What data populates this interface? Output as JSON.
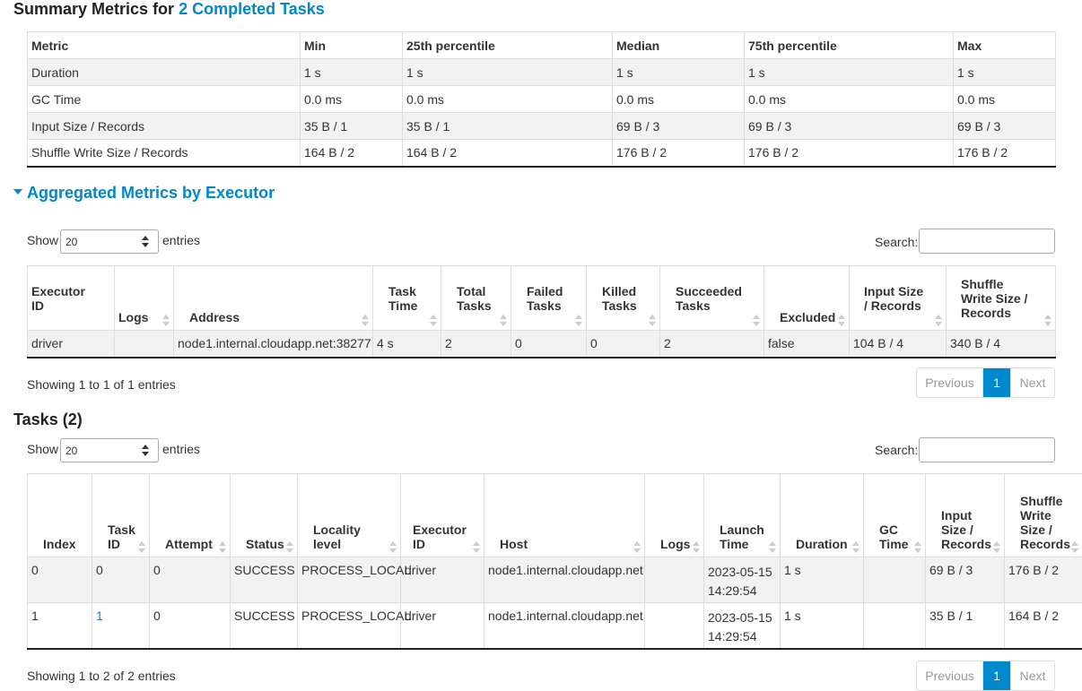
{
  "summary": {
    "title_prefix": "Summary Metrics for ",
    "title_link": "2 Completed Tasks",
    "columns": [
      "Metric",
      "Min",
      "25th percentile",
      "Median",
      "75th percentile",
      "Max"
    ],
    "rows": [
      [
        "Duration",
        "1 s",
        "1 s",
        "1 s",
        "1 s",
        "1 s"
      ],
      [
        "GC Time",
        "0.0 ms",
        "0.0 ms",
        "0.0 ms",
        "0.0 ms",
        "0.0 ms"
      ],
      [
        "Input Size / Records",
        "35 B / 1",
        "35 B / 1",
        "69 B / 3",
        "69 B / 3",
        "69 B / 3"
      ],
      [
        "Shuffle Write Size / Records",
        "164 B / 2",
        "164 B / 2",
        "176 B / 2",
        "176 B / 2",
        "176 B / 2"
      ]
    ]
  },
  "executors": {
    "title": "Aggregated Metrics by Executor",
    "show_label": "Show",
    "entries_label": "entries",
    "page_size": "20",
    "search_label": "Search:",
    "search_value": "",
    "columns": [
      [
        "Executor",
        "ID"
      ],
      [
        "Logs"
      ],
      [
        "Address"
      ],
      [
        "Task",
        "Time"
      ],
      [
        "Total",
        "Tasks"
      ],
      [
        "Failed",
        "Tasks"
      ],
      [
        "Killed",
        "Tasks"
      ],
      [
        "Succeeded",
        "Tasks"
      ],
      [
        "Excluded"
      ],
      [
        "Input Size",
        "/ Records"
      ],
      [
        "Shuffle",
        "Write Size /",
        "Records"
      ]
    ],
    "rows": [
      [
        "driver",
        "",
        "node1.internal.cloudapp.net:38277",
        "4 s",
        "2",
        "0",
        "0",
        "2",
        "false",
        "104 B / 4",
        "340 B / 4"
      ]
    ],
    "info": "Showing 1 to 1 of 1 entries",
    "pager": {
      "previous": "Previous",
      "page": "1",
      "next": "Next"
    }
  },
  "tasks": {
    "title": "Tasks (2)",
    "show_label": "Show",
    "entries_label": "entries",
    "page_size": "20",
    "search_label": "Search:",
    "search_value": "",
    "columns": [
      [
        "Index"
      ],
      [
        "Task",
        "ID"
      ],
      [
        "Attempt"
      ],
      [
        "Status"
      ],
      [
        "Locality",
        "level"
      ],
      [
        "Executor",
        "ID"
      ],
      [
        "Host"
      ],
      [
        "Logs"
      ],
      [
        "Launch",
        "Time"
      ],
      [
        "Duration"
      ],
      [
        "GC",
        "Time"
      ],
      [
        "Input",
        "Size /",
        "Records"
      ],
      [
        "Shuffle",
        "Write",
        "Size /",
        "Records"
      ]
    ],
    "rows": [
      [
        "0",
        "0",
        "0",
        "SUCCESS",
        "PROCESS_LOCAL",
        "driver",
        "node1.internal.cloudapp.net",
        "",
        "2023-05-15 14:29:54",
        "1 s",
        "",
        "69 B / 3",
        "176 B / 2"
      ],
      [
        "1",
        "1",
        "0",
        "SUCCESS",
        "PROCESS_LOCAL",
        "driver",
        "node1.internal.cloudapp.net",
        "",
        "2023-05-15 14:29:54",
        "1 s",
        "",
        "35 B / 1",
        "164 B / 2"
      ]
    ],
    "info": "Showing 1 to 2 of 2 entries",
    "pager": {
      "previous": "Previous",
      "page": "1",
      "next": "Next"
    }
  }
}
